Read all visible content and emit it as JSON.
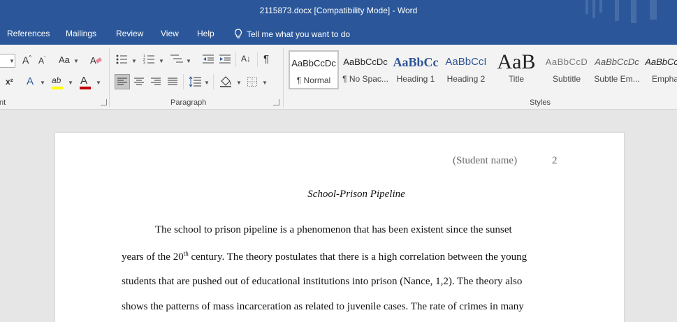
{
  "window": {
    "title": "2115873.docx [Compatibility Mode]  -  Word"
  },
  "tabs": {
    "references": "References",
    "mailings": "Mailings",
    "review": "Review",
    "view": "View",
    "help": "Help",
    "tell_me": "Tell me what you want to do"
  },
  "ribbon": {
    "font_group_label": "nt",
    "paragraph_group_label": "Paragraph",
    "styles_group_label": "Styles",
    "grow_font_glyph": "A",
    "shrink_font_glyph": "A",
    "change_case_glyph": "Aa",
    "superscript_glyph": "x²",
    "text_effects_glyph": "A",
    "highlight_glyph": "ab",
    "font_color_glyph": "A",
    "pilcrow_glyph": "¶",
    "sort_glyph": "A↓",
    "styles": [
      {
        "preview": "AaBbCcDc",
        "name": "¶ Normal"
      },
      {
        "preview": "AaBbCcDc",
        "name": "¶ No Spac..."
      },
      {
        "preview": "AaBbCc",
        "name": "Heading 1"
      },
      {
        "preview": "AaBbCcI",
        "name": "Heading 2"
      },
      {
        "preview": "AaB",
        "name": "Title"
      },
      {
        "preview": "AaBbCcD",
        "name": "Subtitle"
      },
      {
        "preview": "AaBbCcDc",
        "name": "Subtle Em..."
      },
      {
        "preview": "AaBbCcDc",
        "name": "Emphas"
      }
    ]
  },
  "document": {
    "header_name": "(Student name)",
    "page_number": "2",
    "title": "School-Prison Pipeline",
    "line1": "The school to prison pipeline is a phenomenon that has been existent since the sunset",
    "line2_pre": "years of the 20",
    "line2_sup": "th",
    "line2_post": " century. The theory postulates that there is a high correlation between the young",
    "line3": "students that are pushed out of educational institutions into prison (Nance, 1,2). The theory also",
    "line4": "shows the patterns of mass incarceration as related to juvenile cases. The rate of crimes in many"
  },
  "colors": {
    "word_blue": "#2b579a",
    "highlight_yellow": "#ffff00",
    "font_red": "#c00000"
  }
}
